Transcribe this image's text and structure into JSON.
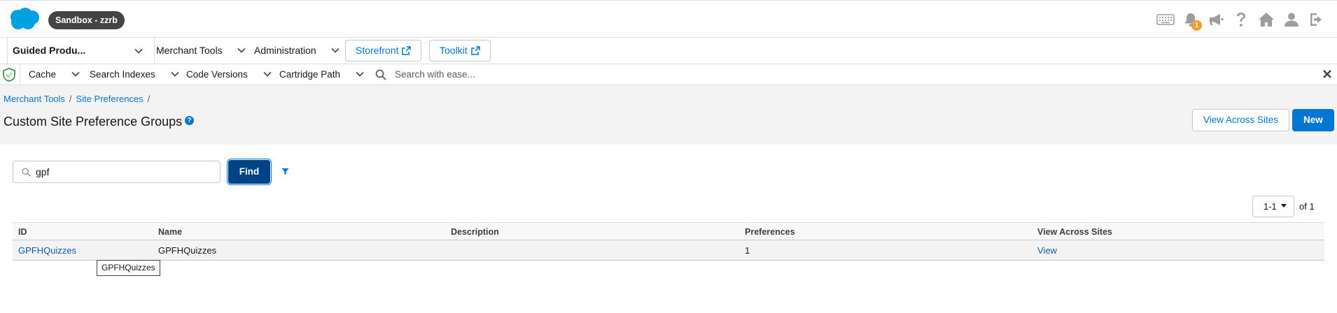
{
  "header": {
    "sandbox_label": "Sandbox - zzrb",
    "notifications_count": "1",
    "icons": [
      "keyboard-icon",
      "bell-icon",
      "megaphone-icon",
      "help-icon",
      "home-icon",
      "user-icon",
      "logout-icon"
    ]
  },
  "nav": {
    "app_label": "Guided Produ...",
    "items": [
      {
        "label": "Merchant Tools"
      },
      {
        "label": "Administration"
      }
    ],
    "storefront_label": "Storefront",
    "toolkit_label": "Toolkit"
  },
  "toolbar": {
    "items": [
      {
        "label": "Cache"
      },
      {
        "label": "Search Indexes"
      },
      {
        "label": "Code Versions"
      },
      {
        "label": "Cartridge Path"
      }
    ],
    "search_placeholder": "Search with ease..."
  },
  "breadcrumb": {
    "items": [
      "Merchant Tools",
      "Site Preferences"
    ],
    "separator": "/"
  },
  "page": {
    "title": "Custom Site Preference Groups",
    "view_across_sites_label": "View Across Sites",
    "new_label": "New"
  },
  "search": {
    "value": "gpf",
    "find_label": "Find"
  },
  "pager": {
    "range": "1-1",
    "of_label": "of 1"
  },
  "table": {
    "columns": [
      "ID",
      "Name",
      "Description",
      "Preferences",
      "View Across Sites"
    ],
    "rows": [
      {
        "id": "GPFHQuizzes",
        "name": "GPFHQuizzes",
        "description": "",
        "preferences": "1",
        "view": "View"
      }
    ]
  },
  "tooltip": {
    "text": "GPFHQuizzes"
  },
  "colors": {
    "brand": "#0176d3",
    "find_button": "#014486",
    "badge": "#f49b23",
    "pill": "#444444"
  }
}
